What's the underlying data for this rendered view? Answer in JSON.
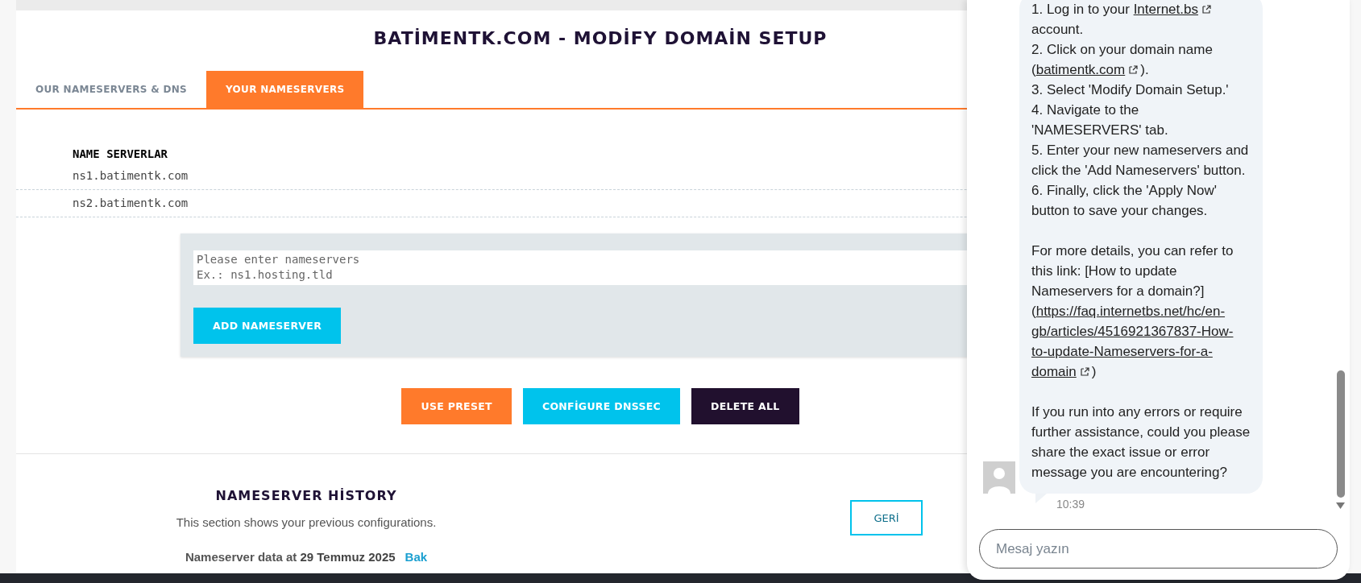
{
  "page": {
    "title": "BATİMENTK.COM - MODİFY DOMAİN SETUP"
  },
  "tabs": [
    {
      "label": "OUR NAMESERVERS & DNS",
      "selected": false
    },
    {
      "label": "YOUR NAMESERVERS",
      "selected": true
    }
  ],
  "nameservers": {
    "heading": "NAME SERVERLAR",
    "rows": [
      "ns1.batimentk.com",
      "ns2.batimentk.com"
    ]
  },
  "add_form": {
    "placeholder": "Please enter nameservers\nEx.: ns1.hosting.tld",
    "button": "ADD NAMESERVER"
  },
  "actions": [
    {
      "label": "USE PRESET",
      "kind": "primary"
    },
    {
      "label": "CONFİGURE DNSSEC",
      "kind": "info"
    },
    {
      "label": "DELETE ALL",
      "kind": "dark"
    }
  ],
  "history": {
    "title": "NAMESERVER HİSTORY",
    "description": "This section shows your previous configurations.",
    "back_button": "GERİ",
    "entry_text": "Nameserver data at **29 Temmuz 2025**",
    "entry_link": "Bak"
  },
  "chat": {
    "groups": [
      [
        [
          {
            "text": "1. Log in to your "
          },
          {
            "text": "Internet.bs",
            "link": true,
            "external": true
          },
          {
            "text": " account."
          }
        ],
        [
          {
            "text": "2. Click on your domain name ("
          },
          {
            "text": "batimentk.com",
            "link": true,
            "external": true
          },
          {
            "text": ")."
          }
        ],
        [
          {
            "text": "3. Select 'Modify Domain Setup.'"
          }
        ],
        [
          {
            "text": "4. Navigate to the 'NAMESERVERS' tab."
          }
        ],
        [
          {
            "text": "5. Enter your new nameservers and click the 'Add Nameservers' button."
          }
        ],
        [
          {
            "text": "6. Finally, click the 'Apply Now' button to save your changes."
          }
        ]
      ],
      [
        [
          {
            "text": "For more details, you can refer to this link: [How to update Nameservers for a domain?] ("
          },
          {
            "text": "https://faq.internetbs.net/hc/en-",
            "link": true
          },
          {
            "text": "gb/articles/4516921367837-How-",
            "link": true
          },
          {
            "text": "to-update-Nameservers-for-a-",
            "link": true
          },
          {
            "text": "domain",
            "link": true,
            "external": true
          },
          {
            "text": ")"
          }
        ]
      ],
      [
        [
          {
            "text": "If you run into any errors or require further assistance, could you please share the exact issue or error message you are encountering?"
          }
        ]
      ]
    ],
    "time": "10:39",
    "input_placeholder": "Mesaj yazın"
  }
}
